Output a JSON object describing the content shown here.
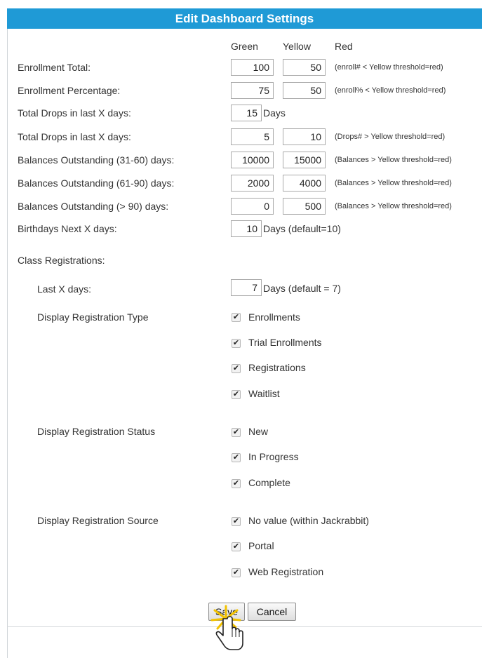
{
  "header": {
    "title": "Edit Dashboard Settings"
  },
  "columns": {
    "green": "Green",
    "yellow": "Yellow",
    "red": "Red"
  },
  "rows": [
    {
      "label": "Enrollment Total:",
      "green": "100",
      "yellow": "50",
      "note": "(enroll# < Yellow threshold=red)"
    },
    {
      "label": "Enrollment Percentage:",
      "green": "75",
      "yellow": "50",
      "note": "(enroll% < Yellow threshold=red)"
    },
    {
      "label": "Total Drops in last X days:",
      "green": "15",
      "unit": "Days"
    },
    {
      "label": "Total Drops in last X days:",
      "green": "5",
      "yellow": "10",
      "note": "(Drops# > Yellow threshold=red)"
    },
    {
      "label": "Balances Outstanding (31-60) days:",
      "green": "10000",
      "yellow": "15000",
      "note": "(Balances > Yellow threshold=red)"
    },
    {
      "label": "Balances Outstanding (61-90) days:",
      "green": "2000",
      "yellow": "4000",
      "note": "(Balances > Yellow threshold=red)"
    },
    {
      "label": "Balances Outstanding (> 90) days:",
      "green": "0",
      "yellow": "500",
      "note": "(Balances > Yellow threshold=red)"
    },
    {
      "label": "Birthdays Next X days:",
      "green": "10",
      "unit": "Days (default=10)"
    }
  ],
  "class_registrations": {
    "heading": "Class Registrations:",
    "last_days_label": "Last X days:",
    "last_days_value": "7",
    "last_days_unit": "Days (default = 7)",
    "type_label": "Display Registration Type",
    "types": [
      "Enrollments",
      "Trial Enrollments",
      "Registrations",
      "Waitlist"
    ],
    "status_label": "Display Registration Status",
    "statuses": [
      "New",
      "In Progress",
      "Complete"
    ],
    "source_label": "Display Registration Source",
    "sources": [
      "No value (within Jackrabbit)",
      "Portal",
      "Web Registration"
    ],
    "checked_glyph": "✔"
  },
  "buttons": {
    "save": "Save",
    "cancel": "Cancel"
  },
  "colors": {
    "header_bg": "#1f9ad6",
    "header_text": "#ffffff"
  },
  "icons": {
    "cursor": "hand-pointer-cursor-icon"
  }
}
